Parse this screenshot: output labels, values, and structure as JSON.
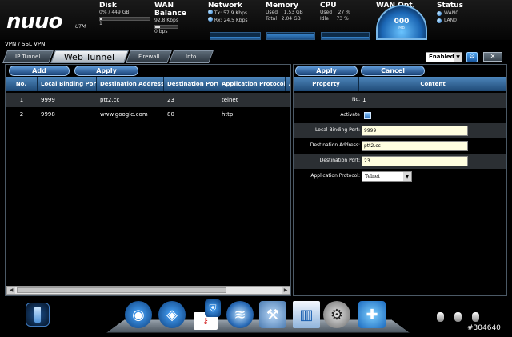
{
  "brand": {
    "logo": "nuuo",
    "sub": "UTM"
  },
  "stats": {
    "disk": {
      "title": "Disk",
      "line1": "0% / 449 GB",
      "line2": "1"
    },
    "wan_balance": {
      "title": "WAN Balance",
      "line1": "92.8 Kbps",
      "line2": "0 bps"
    },
    "network": {
      "title": "Network",
      "tx_label": "Tx:",
      "tx": "57.9 Kbps",
      "rx_label": "Rx:",
      "rx": "24.5 Kbps"
    },
    "memory": {
      "title": "Memory",
      "used_label": "Used",
      "used": "1.53 GB",
      "total_label": "Total",
      "total": "2.04 GB"
    },
    "cpu": {
      "title": "CPU",
      "used_label": "Used",
      "used": "27 %",
      "idle_label": "Idle",
      "idle": "73 %"
    },
    "wan_opt": {
      "title": "WAN Opt.",
      "value": "000",
      "unit": "MB"
    },
    "status": {
      "title": "Status",
      "items": [
        "WAN0",
        "LAN0"
      ]
    }
  },
  "breadcrumb": "VPN / SSL VPN",
  "tabs": [
    {
      "label": "IP Tunnel"
    },
    {
      "label": "Web Tunnel"
    },
    {
      "label": "Firewall"
    },
    {
      "label": "Info"
    }
  ],
  "enabled_select": {
    "value": "Enabled"
  },
  "left": {
    "add_label": "Add",
    "apply_label": "Apply",
    "columns": [
      "No.",
      "Local Binding Port",
      "Destination Address",
      "Destination Port",
      "Application Protocol",
      "A"
    ],
    "rows": [
      {
        "no": "1",
        "port": "9999",
        "address": "ptt2.cc",
        "dport": "23",
        "protocol": "telnet"
      },
      {
        "no": "2",
        "port": "9998",
        "address": "www.google.com",
        "dport": "80",
        "protocol": "http"
      }
    ]
  },
  "right": {
    "apply_label": "Apply",
    "cancel_label": "Cancel",
    "columns": [
      "Property",
      "Content"
    ],
    "no_label": "No.",
    "no_value": "1",
    "activate_label": "Activate",
    "local_port_label": "Local Binding Port:",
    "local_port_value": "9999",
    "dest_addr_label": "Destination Address:",
    "dest_addr_value": "ptt2.cc",
    "dest_port_label": "Destination Port:",
    "dest_port_value": "23",
    "app_proto_label": "Application Protocol:",
    "app_proto_value": "Telnet"
  },
  "watermark": "#304640"
}
